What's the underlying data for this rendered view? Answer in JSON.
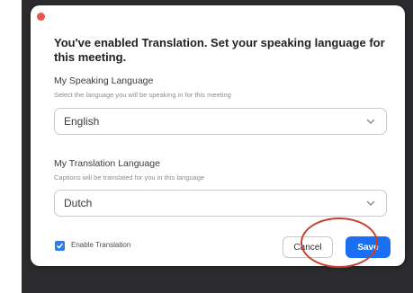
{
  "dialog": {
    "title": "You've enabled Translation. Set your speaking language for this meeting.",
    "speaking": {
      "label": "My Speaking Language",
      "help": "Select the language you will be speaking in for this meeting",
      "value": "English"
    },
    "translation": {
      "label": "My Translation Language",
      "help": "Captions will be translated for you in this language",
      "value": "Dutch"
    },
    "enable_translation": {
      "label": "Enable Translation",
      "checked": true
    },
    "cancel_label": "Cancel",
    "save_label": "Save"
  },
  "colors": {
    "accent": "#1a6ff2",
    "close": "#e8554e",
    "annotation": "#c6402e"
  },
  "icons": {
    "close": "close-dot-icon",
    "dropdown": "chevron-down-icon",
    "check": "checkmark-icon"
  }
}
